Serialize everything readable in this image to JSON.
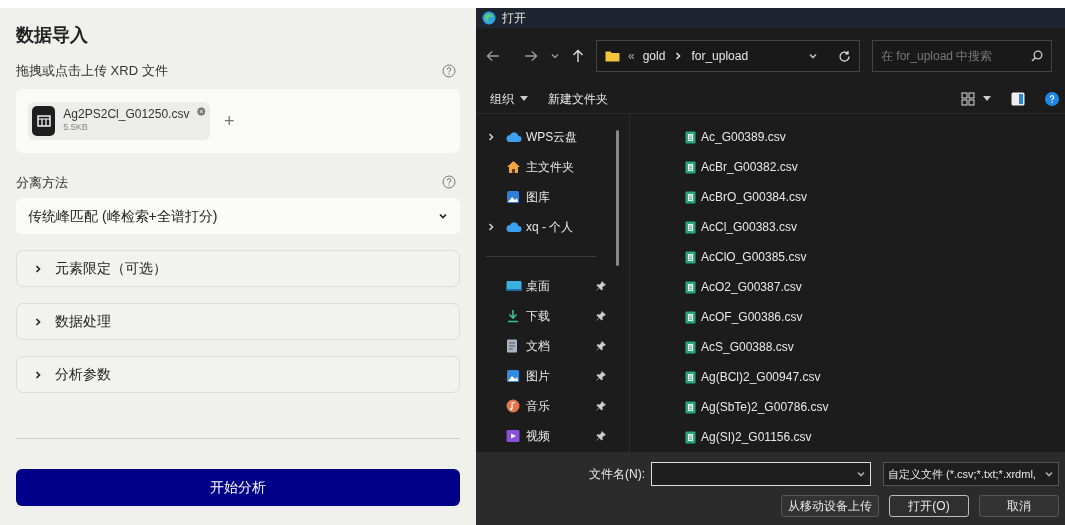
{
  "panel": {
    "title": "数据导入",
    "upload": {
      "label": "拖拽或点击上传 XRD 文件",
      "files": [
        {
          "name": "Ag2PS2Cl_G01250.csv",
          "size": "5.5KB"
        }
      ],
      "add": "+"
    },
    "method": {
      "label": "分离方法",
      "value": "传统峰匹配 (峰检索+全谱打分)"
    },
    "sections": [
      {
        "label": "元素限定（可选）",
        "expanded": false
      },
      {
        "label": "数据处理",
        "expanded": false
      },
      {
        "label": "分析参数",
        "expanded": false
      }
    ],
    "submit": "开始分析"
  },
  "dialog": {
    "title": "打开",
    "breadcrumb": {
      "overflow": "«",
      "parts": [
        "gold",
        "for_upload"
      ]
    },
    "search": {
      "placeholder": "在 for_upload 中搜索"
    },
    "toolbar": [
      "组织",
      "新建文件夹"
    ],
    "nav": [
      {
        "label": "WPS云盘",
        "kind": "cloud",
        "has_children": true,
        "pinned": false
      },
      {
        "label": "主文件夹",
        "kind": "home",
        "has_children": false,
        "pinned": false
      },
      {
        "label": "图库",
        "kind": "gallery",
        "has_children": false,
        "pinned": false
      },
      {
        "label": "xq - 个人",
        "kind": "cloud",
        "has_children": true,
        "pinned": false
      },
      {
        "kind": "divider"
      },
      {
        "label": "桌面",
        "kind": "desktop",
        "has_children": false,
        "pinned": true
      },
      {
        "label": "下载",
        "kind": "download",
        "has_children": false,
        "pinned": true
      },
      {
        "label": "文档",
        "kind": "document",
        "has_children": false,
        "pinned": true
      },
      {
        "label": "图片",
        "kind": "pictures",
        "has_children": false,
        "pinned": true
      },
      {
        "label": "音乐",
        "kind": "music",
        "has_children": false,
        "pinned": true
      },
      {
        "label": "视频",
        "kind": "video",
        "has_children": false,
        "pinned": true
      }
    ],
    "files": [
      "Ac_G00389.csv",
      "AcBr_G00382.csv",
      "AcBrO_G00384.csv",
      "AcCl_G00383.csv",
      "AcClO_G00385.csv",
      "AcO2_G00387.csv",
      "AcOF_G00386.csv",
      "AcS_G00388.csv",
      "Ag(BCl)2_G00947.csv",
      "Ag(SbTe)2_G00786.csv",
      "Ag(SI)2_G01156.csv"
    ],
    "filename_label": "文件名(N):",
    "filetype": "自定义文件 (*.csv;*.txt;*.xrdml,",
    "buttons": [
      "从移动设备上传",
      "打开(O)",
      "取消"
    ]
  }
}
